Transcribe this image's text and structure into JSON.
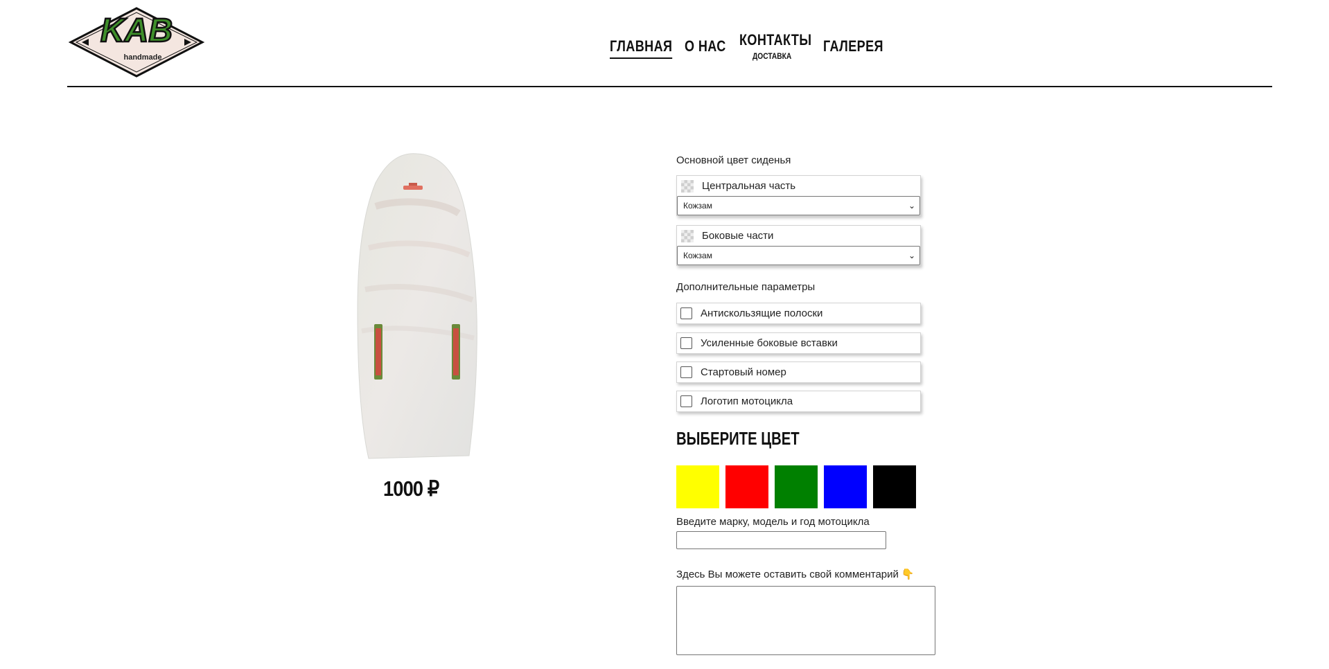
{
  "header": {
    "logo_text": "KAB",
    "logo_sub": "handmade",
    "nav": [
      {
        "label": "ГЛАВНАЯ",
        "active": true
      },
      {
        "label": "О НАС"
      },
      {
        "label": "КОНТАКТЫ",
        "sub": "ДОСТАВКА"
      },
      {
        "label": "ГАЛЕРЕЯ"
      }
    ]
  },
  "product": {
    "price": "1000 ₽",
    "image_icon": "motorcycle-seat-image"
  },
  "form": {
    "main_color_label": "Основной цвет сиденья",
    "center_part": {
      "label": "Центральная часть",
      "value": "Кожзам"
    },
    "side_parts": {
      "label": "Боковые части",
      "value": "Кожзам"
    },
    "extra_label": "Дополнительные параметры",
    "extras": [
      {
        "label": "Антискользящие полоски",
        "checked": false
      },
      {
        "label": "Усиленные боковые вставки",
        "checked": false
      },
      {
        "label": "Стартовый номер",
        "checked": false
      },
      {
        "label": "Логотип мотоцикла",
        "checked": false
      }
    ],
    "choose_color_title": "ВЫБЕРИТЕ ЦВЕТ",
    "colors": [
      "#ffff00",
      "#ff0000",
      "#008000",
      "#0000ff",
      "#000000"
    ],
    "bike_label": "Введите марку, модель и год мотоцикла",
    "bike_value": "",
    "comment_label": "Здесь Вы можете оставить свой комментарий",
    "comment_icon": "pointing-hand-icon",
    "comment_value": ""
  }
}
